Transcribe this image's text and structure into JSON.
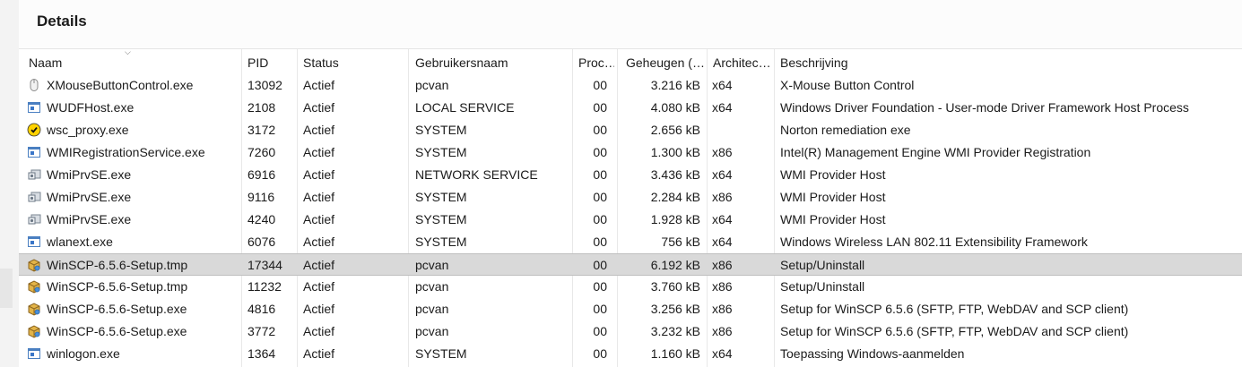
{
  "title": "Details",
  "columns": {
    "name": "Naam",
    "pid": "PID",
    "status": "Status",
    "user": "Gebruikersnaam",
    "proc": "Proc…",
    "mem": "Geheugen (…",
    "arch": "Architec…",
    "desc": "Beschrijving"
  },
  "rows": [
    {
      "icon": "mouse-icon",
      "name": "XMouseButtonControl.exe",
      "pid": "13092",
      "status": "Actief",
      "user": "pcvan",
      "proc": "00",
      "mem": "3.216 kB",
      "arch": "x64",
      "desc": "X-Mouse Button Control"
    },
    {
      "icon": "window-app-icon",
      "name": "WUDFHost.exe",
      "pid": "2108",
      "status": "Actief",
      "user": "LOCAL SERVICE",
      "proc": "00",
      "mem": "4.080 kB",
      "arch": "x64",
      "desc": "Windows Driver Foundation - User-mode Driver Framework Host Process"
    },
    {
      "icon": "norton-icon",
      "name": "wsc_proxy.exe",
      "pid": "3172",
      "status": "Actief",
      "user": "SYSTEM",
      "proc": "00",
      "mem": "2.656 kB",
      "arch": "",
      "desc": "Norton remediation exe"
    },
    {
      "icon": "window-app-icon",
      "name": "WMIRegistrationService.exe",
      "pid": "7260",
      "status": "Actief",
      "user": "SYSTEM",
      "proc": "00",
      "mem": "1.300 kB",
      "arch": "x86",
      "desc": "Intel(R) Management Engine WMI Provider Registration"
    },
    {
      "icon": "wmi-icon",
      "name": "WmiPrvSE.exe",
      "pid": "6916",
      "status": "Actief",
      "user": "NETWORK SERVICE",
      "proc": "00",
      "mem": "3.436 kB",
      "arch": "x64",
      "desc": "WMI Provider Host"
    },
    {
      "icon": "wmi-icon",
      "name": "WmiPrvSE.exe",
      "pid": "9116",
      "status": "Actief",
      "user": "SYSTEM",
      "proc": "00",
      "mem": "2.284 kB",
      "arch": "x86",
      "desc": "WMI Provider Host"
    },
    {
      "icon": "wmi-icon",
      "name": "WmiPrvSE.exe",
      "pid": "4240",
      "status": "Actief",
      "user": "SYSTEM",
      "proc": "00",
      "mem": "1.928 kB",
      "arch": "x64",
      "desc": "WMI Provider Host"
    },
    {
      "icon": "window-app-icon",
      "name": "wlanext.exe",
      "pid": "6076",
      "status": "Actief",
      "user": "SYSTEM",
      "proc": "00",
      "mem": "756 kB",
      "arch": "x64",
      "desc": "Windows Wireless LAN 802.11 Extensibility Framework"
    },
    {
      "icon": "setup-box-icon",
      "name": "WinSCP-6.5.6-Setup.tmp",
      "pid": "17344",
      "status": "Actief",
      "user": "pcvan",
      "proc": "00",
      "mem": "6.192 kB",
      "arch": "x86",
      "desc": "Setup/Uninstall",
      "selected": true
    },
    {
      "icon": "setup-box-icon",
      "name": "WinSCP-6.5.6-Setup.tmp",
      "pid": "11232",
      "status": "Actief",
      "user": "pcvan",
      "proc": "00",
      "mem": "3.760 kB",
      "arch": "x86",
      "desc": "Setup/Uninstall"
    },
    {
      "icon": "setup-box-icon",
      "name": "WinSCP-6.5.6-Setup.exe",
      "pid": "4816",
      "status": "Actief",
      "user": "pcvan",
      "proc": "00",
      "mem": "3.256 kB",
      "arch": "x86",
      "desc": "Setup for WinSCP 6.5.6 (SFTP, FTP, WebDAV and SCP client)"
    },
    {
      "icon": "setup-box-icon",
      "name": "WinSCP-6.5.6-Setup.exe",
      "pid": "3772",
      "status": "Actief",
      "user": "pcvan",
      "proc": "00",
      "mem": "3.232 kB",
      "arch": "x86",
      "desc": "Setup for WinSCP 6.5.6 (SFTP, FTP, WebDAV and SCP client)"
    },
    {
      "icon": "window-app-icon",
      "name": "winlogon.exe",
      "pid": "1364",
      "status": "Actief",
      "user": "SYSTEM",
      "proc": "00",
      "mem": "1.160 kB",
      "arch": "x64",
      "desc": "Toepassing Windows-aanmelden"
    }
  ]
}
